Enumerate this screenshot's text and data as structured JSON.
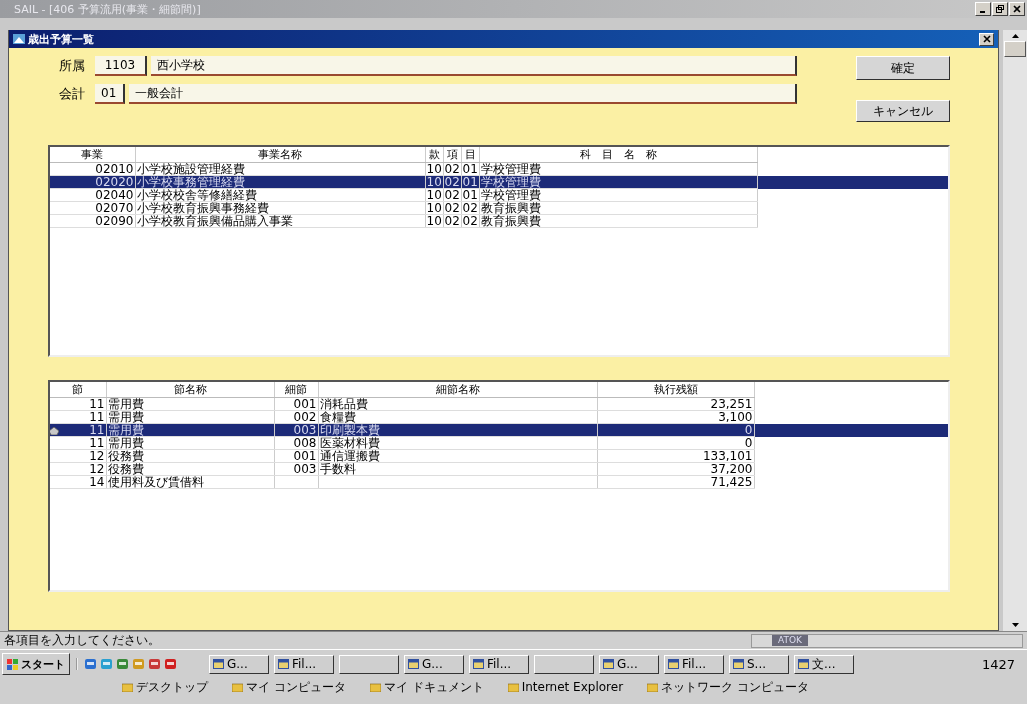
{
  "window": {
    "title": "SAIL - [406 予算流用(事業・細節間)]"
  },
  "dialog": {
    "title": "歳出予算一覧",
    "fields": [
      {
        "label": "所属",
        "code": "1103",
        "name": "西小学校"
      },
      {
        "label": "会計",
        "code": "01",
        "name": "一般会計"
      }
    ],
    "buttons": [
      "確定",
      "キャンセル"
    ],
    "upper_table": {
      "columns": [
        "事業",
        "事業名称",
        "款",
        "項",
        "目",
        "科　目　名　称"
      ],
      "rows": [
        {
          "cells": [
            "02010",
            "小学校施設管理経費",
            "10",
            "02",
            "01",
            "学校管理費"
          ],
          "selected": false
        },
        {
          "cells": [
            "02020",
            "小学校事務管理経費",
            "10",
            "02",
            "01",
            "学校管理費"
          ],
          "selected": true
        },
        {
          "cells": [
            "02040",
            "小学校校舎等修繕経費",
            "10",
            "02",
            "01",
            "学校管理費"
          ],
          "selected": false
        },
        {
          "cells": [
            "02070",
            "小学校教育振興事務経費",
            "10",
            "02",
            "02",
            "教育振興費"
          ],
          "selected": false
        },
        {
          "cells": [
            "02090",
            "小学校教育振興備品購入事業",
            "10",
            "02",
            "02",
            "教育振興費"
          ],
          "selected": false
        }
      ]
    },
    "lower_table": {
      "columns": [
        "節",
        "節名称",
        "細節",
        "細節名称",
        "執行残額"
      ],
      "rows": [
        {
          "cells": [
            "11",
            "需用費",
            "001",
            "消耗品費",
            "23,251"
          ],
          "selected": false
        },
        {
          "cells": [
            "11",
            "需用費",
            "002",
            "食糧費",
            "3,100"
          ],
          "selected": false
        },
        {
          "cells": [
            "11",
            "需用費",
            "003",
            "印刷製本費",
            "0"
          ],
          "selected": true
        },
        {
          "cells": [
            "11",
            "需用費",
            "008",
            "医薬材料費",
            "0"
          ],
          "selected": false
        },
        {
          "cells": [
            "12",
            "役務費",
            "001",
            "通信運搬費",
            "133,101"
          ],
          "selected": false
        },
        {
          "cells": [
            "12",
            "役務費",
            "003",
            "手数料",
            "37,200"
          ],
          "selected": false
        },
        {
          "cells": [
            "14",
            "使用料及び賃借料",
            "",
            "",
            "71,425"
          ],
          "selected": false
        }
      ]
    }
  },
  "status_bar": "各項目を入力してください。",
  "ime": "ATOK",
  "taskbar": {
    "start": "スタート",
    "tasks": [
      {
        "kind": "task",
        "label": "G..."
      },
      {
        "kind": "task",
        "label": "Fil..."
      },
      {
        "kind": "empty"
      },
      {
        "kind": "task",
        "label": "G..."
      },
      {
        "kind": "task",
        "label": "Fil..."
      },
      {
        "kind": "empty"
      },
      {
        "kind": "task",
        "label": "G..."
      },
      {
        "kind": "task",
        "label": "Fil..."
      },
      {
        "kind": "task",
        "label": "S..."
      },
      {
        "kind": "task",
        "label": "文..."
      }
    ],
    "clock": "1427",
    "desktop_items": [
      "デスクトップ",
      "マイ コンピュータ",
      "マイ ドキュメント",
      "Internet Explorer",
      "ネットワーク コンピュータ"
    ]
  }
}
